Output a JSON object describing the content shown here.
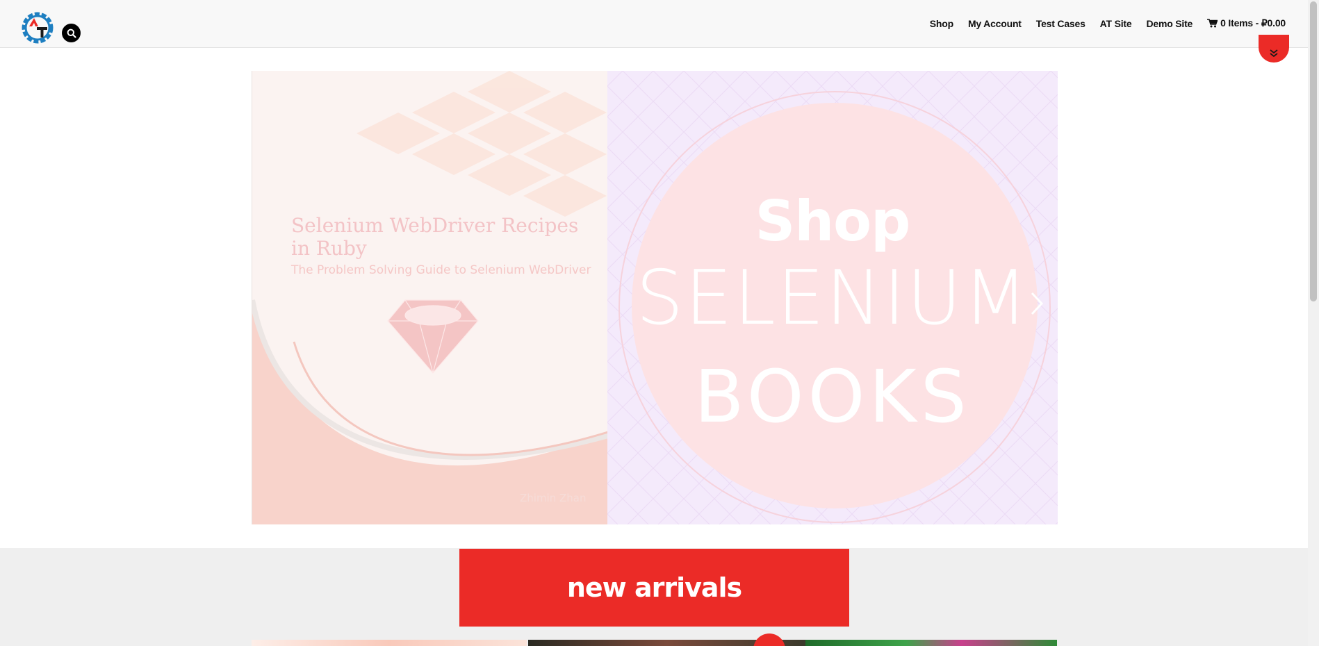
{
  "header": {
    "logo_alt": "AT",
    "nav": {
      "shop": "Shop",
      "my_account": "My Account",
      "test_cases": "Test Cases",
      "at_site": "AT Site",
      "demo_site": "Demo Site"
    },
    "cart": {
      "label": "0 Items - ₽0.00",
      "icon": "shopping-cart-icon"
    },
    "search_icon": "search-icon"
  },
  "slider": {
    "left_slide": {
      "title": "Selenium WebDriver Recipes in Ruby",
      "subtitle": "The Problem Solving Guide to Selenium WebDriver",
      "author": "Zhimin Zhan"
    },
    "right_slide": {
      "line1": "Shop",
      "line2": "SELENIUM",
      "line3": "BOOKS"
    },
    "next_icon": "chevron-right-icon"
  },
  "arrivals": {
    "heading": "new arrivals"
  },
  "colors": {
    "accent": "#eb2b27",
    "header_bg": "#f8f8f8",
    "logo_blue": "#1e7fc1"
  }
}
